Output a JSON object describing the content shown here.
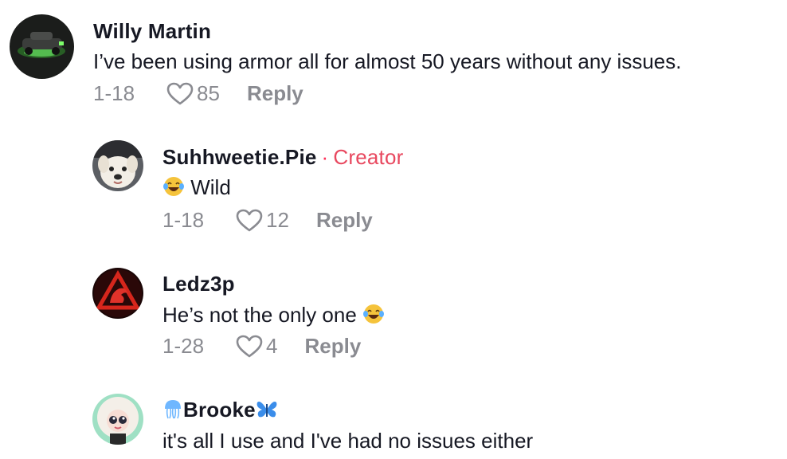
{
  "comments": [
    {
      "username": "Willy Martin",
      "text": "I’ve been using armor all for almost 50 years without any issues.",
      "date": "1-18",
      "likes": "85",
      "reply_label": "Reply",
      "avatar_icon": "car-avatar"
    },
    {
      "username": "Suhhweetie.Pie",
      "separator": "·",
      "badge": "Creator",
      "text": "Wild",
      "text_emoji": "laughing-tears-emoji",
      "date": "1-18",
      "likes": "12",
      "reply_label": "Reply",
      "avatar_icon": "dog-avatar"
    },
    {
      "username": "Ledz3p",
      "text": "He’s not the only one",
      "text_emoji": "laughing-tears-emoji",
      "date": "1-28",
      "likes": "4",
      "reply_label": "Reply",
      "avatar_icon": "scorpion-logo-avatar"
    },
    {
      "username": "Brooke",
      "username_prefix_icon": "jellyfish-emoji",
      "username_suffix_icon": "butterfly-emoji",
      "text": "it's all I use and I've had no issues either",
      "avatar_icon": "cartoon-girl-avatar"
    }
  ],
  "colors": {
    "text": "#161823",
    "muted": "#8a8b91",
    "creator": "#e8485f"
  }
}
